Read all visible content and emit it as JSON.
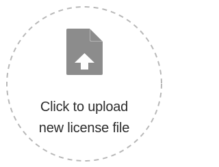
{
  "upload": {
    "label_line1": "Click to upload",
    "label_line2": "new license file",
    "icon": "file-upload-icon",
    "colors": {
      "dashed_border": "#b8b8b8",
      "icon_fill": "#8c8c8c",
      "icon_arrow": "#ffffff",
      "text": "#2b2b2b",
      "background": "#ffffff"
    }
  }
}
